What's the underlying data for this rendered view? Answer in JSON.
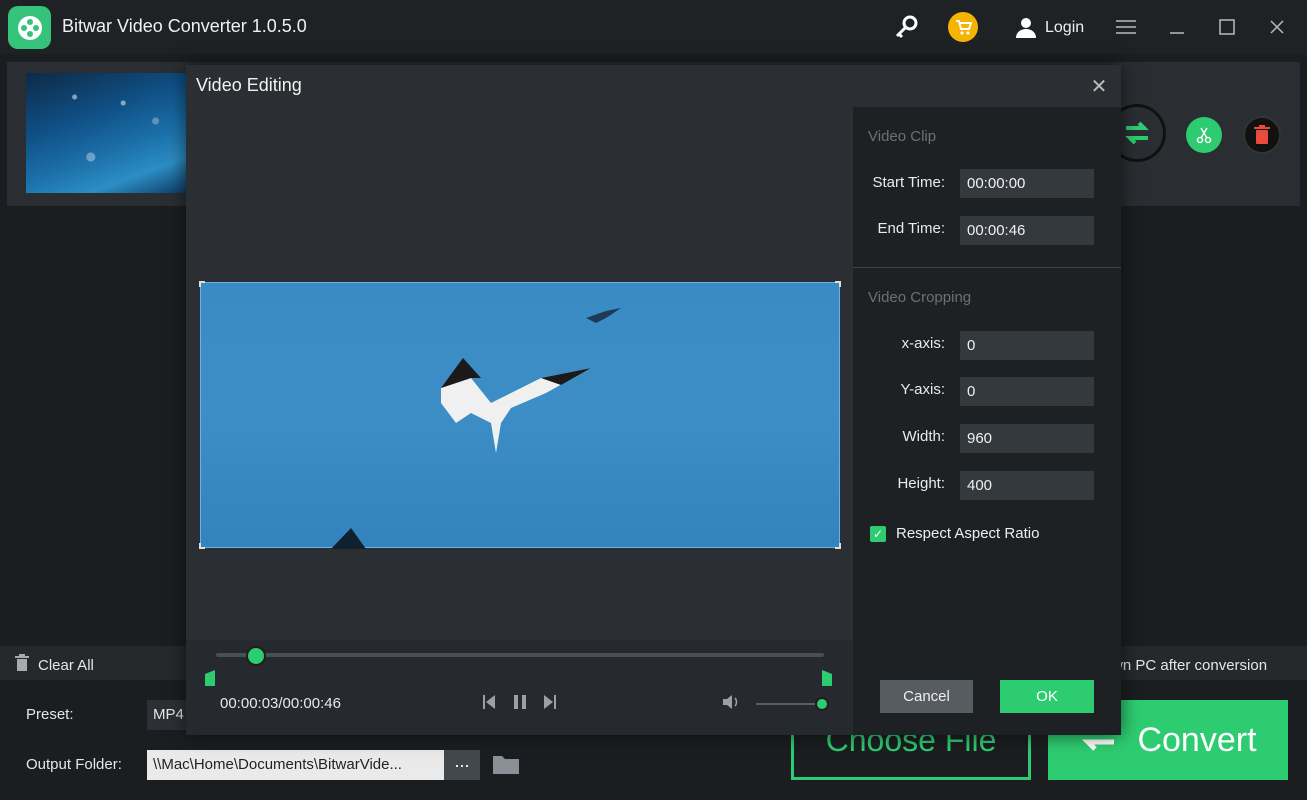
{
  "app": {
    "title": "Bitwar Video Converter  1.0.5.0",
    "login_label": "Login"
  },
  "toolbar": {
    "clear_all_label": "Clear All",
    "shutdown_label": "wn PC after conversion"
  },
  "bottom": {
    "preset_label": "Preset:",
    "preset_value": "MP4",
    "output_label": "Output Folder:",
    "output_value": "\\\\Mac\\Home\\Documents\\BitwarVide...",
    "browse_label": "...",
    "choose_file_label": "Choose File",
    "convert_label": "Convert"
  },
  "dialog": {
    "title": "Video Editing",
    "close_label": "✕",
    "clip": {
      "section_title": "Video Clip",
      "start_label": "Start Time:",
      "start_value": "00:00:00",
      "end_label": "End Time:",
      "end_value": "00:00:46"
    },
    "crop": {
      "section_title": "Video Cropping",
      "x_label": "x-axis:",
      "x_value": "0",
      "y_label": "Y-axis:",
      "y_value": "0",
      "width_label": "Width:",
      "width_value": "960",
      "height_label": "Height:",
      "height_value": "400",
      "aspect_label": "Respect Aspect Ratio",
      "aspect_checked": true
    },
    "cancel_label": "Cancel",
    "ok_label": "OK",
    "player": {
      "time_readout": "00:00:03/00:00:46",
      "progress": 0.065,
      "volume": 1.0
    }
  },
  "colors": {
    "accent": "#2ecc71",
    "delete": "#e74c3c",
    "background": "#1b1e21",
    "dialog": "#2b2f33"
  }
}
